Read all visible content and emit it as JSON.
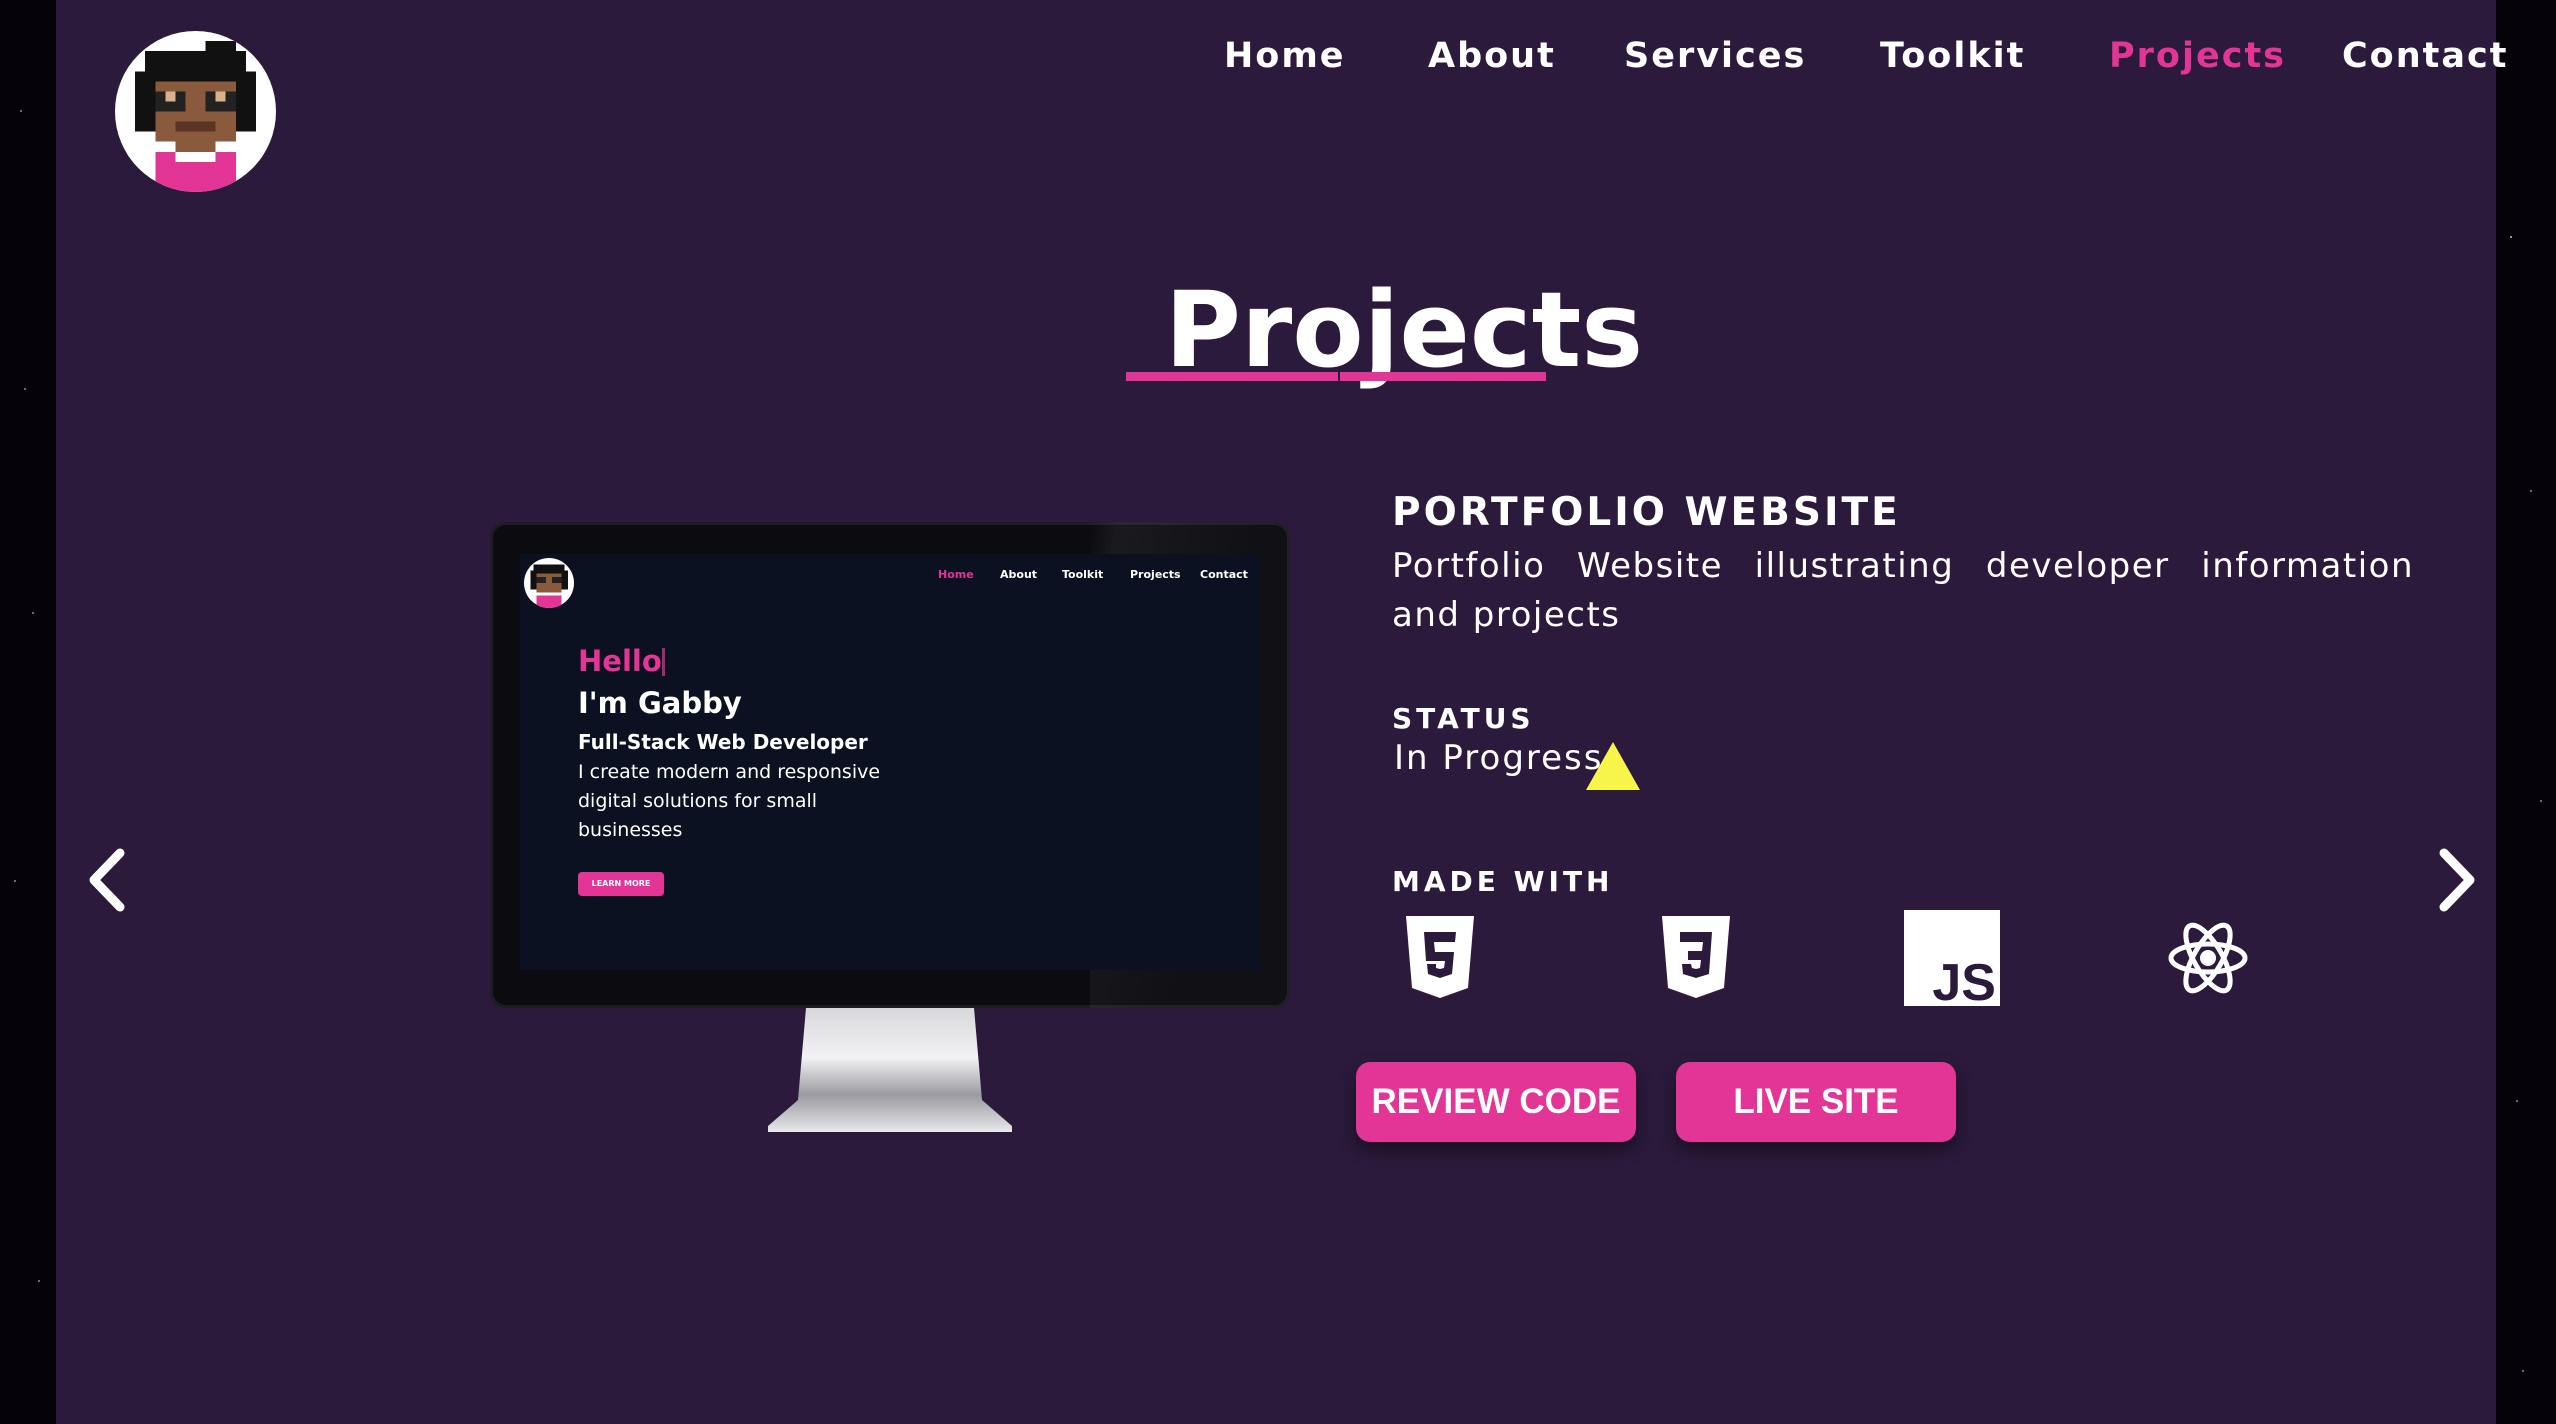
{
  "nav": {
    "items": [
      "Home",
      "About",
      "Services",
      "Toolkit",
      "Projects",
      "Contact"
    ],
    "active": "Projects"
  },
  "page": {
    "title": "Projects"
  },
  "project": {
    "name": "PORTFOLIO WEBSITE",
    "description": "Portfolio Website illustrating developer information and projects",
    "status_label": "STATUS",
    "status": "In Progress",
    "made_with_label": "MADE WITH",
    "technologies": [
      "html5-icon",
      "css3-icon",
      "javascript-icon",
      "react-icon"
    ],
    "review_code_label": "REVIEW CODE",
    "live_site_label": "LIVE SITE"
  },
  "preview": {
    "nav": [
      "Home",
      "About",
      "Toolkit",
      "Projects",
      "Contact"
    ],
    "hello": "Hello",
    "name": "I'm Gabby",
    "role": "Full-Stack Web Developer",
    "description": "I create modern and responsive digital solutions for small businesses",
    "button": "LEARN MORE"
  },
  "colors": {
    "accent": "#e23596",
    "panel": "#2b1a3b",
    "status_warning": "#f7f54a"
  }
}
